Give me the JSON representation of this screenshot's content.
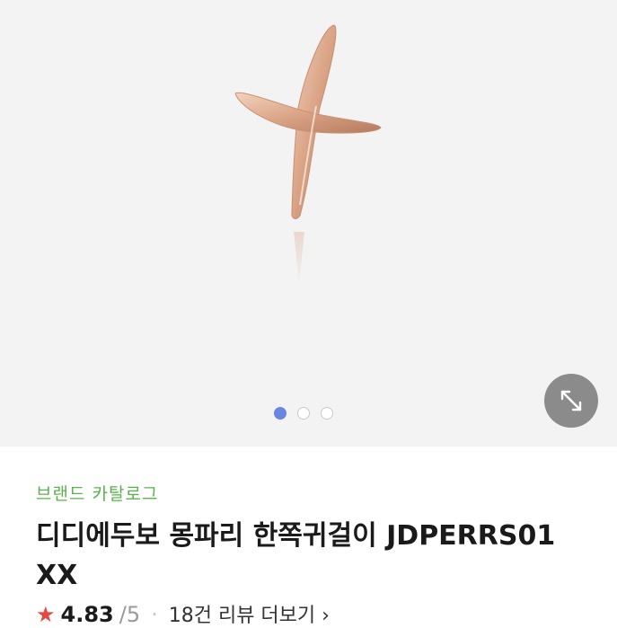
{
  "gallery": {
    "image_alt": "product-cross-earring",
    "pages": 3,
    "active_page": 1,
    "zoom_icon": "expand-arrows-icon"
  },
  "product": {
    "brand_catalog_label": "브랜드 카탈로그",
    "title": "디디에두보 몽파리 한쪽귀걸이 JDPERRS01 XX"
  },
  "rating": {
    "star_icon": "star-icon",
    "value": "4.83",
    "max": "/5",
    "separator": "·",
    "review_link": "18건 리뷰 더보기 ›"
  },
  "colors": {
    "brand_green": "#58b34a",
    "active_dot": "#6a86e0",
    "star_red": "#e8463f",
    "gallery_bg": "#f3f3f3"
  }
}
